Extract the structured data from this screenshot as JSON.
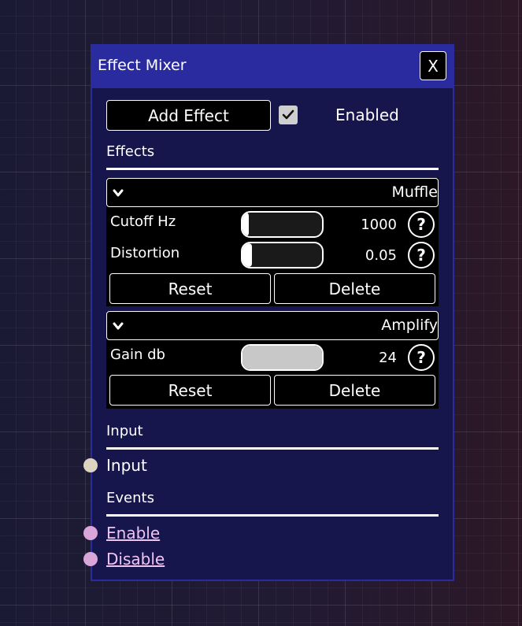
{
  "window": {
    "title": "Effect Mixer",
    "close_label": "X"
  },
  "toolbar": {
    "add_effect_label": "Add Effect",
    "enabled_checked": true,
    "enabled_label": "Enabled"
  },
  "effects_section": {
    "label": "Effects"
  },
  "effects": [
    {
      "name": "Muffle",
      "params": [
        {
          "label": "Cutoff Hz",
          "value": "1000",
          "slider_level": 0.0
        },
        {
          "label": "Distortion",
          "value": "0.05",
          "slider_level": 0.02
        }
      ],
      "reset_label": "Reset",
      "delete_label": "Delete"
    },
    {
      "name": "Amplify",
      "params": [
        {
          "label": "Gain db",
          "value": "24",
          "slider_level": 1.0
        }
      ],
      "reset_label": "Reset",
      "delete_label": "Delete"
    }
  ],
  "help_label": "?",
  "input_section": {
    "label": "Input",
    "port_label": "Input"
  },
  "events_section": {
    "label": "Events",
    "events": [
      "Enable",
      "Disable"
    ]
  },
  "colors": {
    "panel": "#16164d",
    "titlebar": "#2b2ba0",
    "input_port": "#dcd4c0",
    "event_port": "#d9a6d9",
    "event_text": "#f0c4f0"
  }
}
